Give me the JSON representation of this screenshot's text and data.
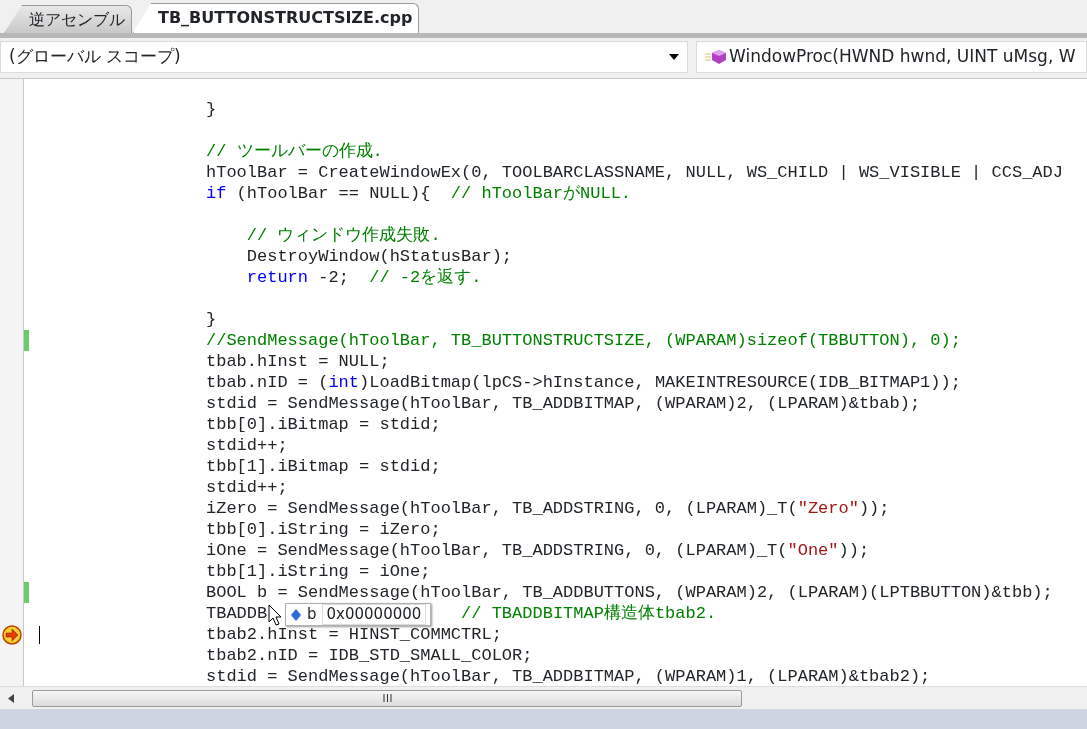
{
  "tabs": [
    {
      "label": "逆アセンブル",
      "selected": false
    },
    {
      "label": "TB_BUTTONSTRUCTSIZE.cpp",
      "selected": true
    }
  ],
  "scope_dropdown": {
    "value": "(グローバル スコープ)"
  },
  "member_dropdown": {
    "value": "WindowProc(HWND hwnd, UINT uMsg, W"
  },
  "code_lines": [
    {
      "changed": false,
      "current": false,
      "segments": [
        {
          "kind": "plain",
          "text": "}"
        }
      ]
    },
    {
      "changed": false,
      "current": false
    },
    {
      "changed": false,
      "current": false,
      "segments": [
        {
          "kind": "comment",
          "text": "// ツールバーの作成."
        }
      ]
    },
    {
      "changed": false,
      "current": false,
      "segments": [
        {
          "kind": "plain",
          "text": "hToolBar = CreateWindowEx(0, TOOLBARCLASSNAME, NULL, WS_CHILD | WS_VISIBLE | CCS_ADJ"
        }
      ]
    },
    {
      "changed": false,
      "current": false,
      "segments": [
        {
          "kind": "keyword",
          "text": "if"
        },
        {
          "kind": "plain",
          "text": " (hToolBar == NULL){  "
        },
        {
          "kind": "comment",
          "text": "// hToolBarがNULL."
        }
      ]
    },
    {
      "changed": false,
      "current": false
    },
    {
      "changed": false,
      "current": false,
      "segments": [
        {
          "kind": "comment",
          "text": "    // ウィンドウ作成失敗."
        }
      ]
    },
    {
      "changed": false,
      "current": false,
      "segments": [
        {
          "kind": "plain",
          "text": "    DestroyWindow(hStatusBar);"
        }
      ]
    },
    {
      "changed": false,
      "current": false,
      "segments": [
        {
          "kind": "keyword",
          "text": "    return"
        },
        {
          "kind": "plain",
          "text": " -2;  "
        },
        {
          "kind": "comment",
          "text": "// -2を返す."
        }
      ]
    },
    {
      "changed": false,
      "current": false
    },
    {
      "changed": false,
      "current": false,
      "segments": [
        {
          "kind": "plain",
          "text": "}"
        }
      ]
    },
    {
      "changed": true,
      "current": false,
      "segments": [
        {
          "kind": "comment",
          "text": "//SendMessage(hToolBar, TB_BUTTONSTRUCTSIZE, (WPARAM)sizeof(TBBUTTON), 0);"
        }
      ]
    },
    {
      "changed": false,
      "current": false,
      "segments": [
        {
          "kind": "plain",
          "text": "tbab.hInst = NULL;"
        }
      ]
    },
    {
      "changed": false,
      "current": false,
      "segments": [
        {
          "kind": "plain",
          "text": "tbab.nID = ("
        },
        {
          "kind": "keyword",
          "text": "int"
        },
        {
          "kind": "plain",
          "text": ")LoadBitmap(lpCS->hInstance, MAKEINTRESOURCE(IDB_BITMAP1));"
        }
      ]
    },
    {
      "changed": false,
      "current": false,
      "segments": [
        {
          "kind": "plain",
          "text": "stdid = SendMessage(hToolBar, TB_ADDBITMAP, (WPARAM)2, (LPARAM)&tbab);"
        }
      ]
    },
    {
      "changed": false,
      "current": false,
      "segments": [
        {
          "kind": "plain",
          "text": "tbb[0].iBitmap = stdid;"
        }
      ]
    },
    {
      "changed": false,
      "current": false,
      "segments": [
        {
          "kind": "plain",
          "text": "stdid++;"
        }
      ]
    },
    {
      "changed": false,
      "current": false,
      "segments": [
        {
          "kind": "plain",
          "text": "tbb[1].iBitmap = stdid;"
        }
      ]
    },
    {
      "changed": false,
      "current": false,
      "segments": [
        {
          "kind": "plain",
          "text": "stdid++;"
        }
      ]
    },
    {
      "changed": false,
      "current": false,
      "segments": [
        {
          "kind": "plain",
          "text": "iZero = SendMessage(hToolBar, TB_ADDSTRING, 0, (LPARAM)_T("
        },
        {
          "kind": "string",
          "text": "\"Zero\""
        },
        {
          "kind": "plain",
          "text": "));"
        }
      ]
    },
    {
      "changed": false,
      "current": false,
      "segments": [
        {
          "kind": "plain",
          "text": "tbb[0].iString = iZero;"
        }
      ]
    },
    {
      "changed": false,
      "current": false,
      "segments": [
        {
          "kind": "plain",
          "text": "iOne = SendMessage(hToolBar, TB_ADDSTRING, 0, (LPARAM)_T("
        },
        {
          "kind": "string",
          "text": "\"One\""
        },
        {
          "kind": "plain",
          "text": "));"
        }
      ]
    },
    {
      "changed": false,
      "current": false,
      "segments": [
        {
          "kind": "plain",
          "text": "tbb[1].iString = iOne;"
        }
      ]
    },
    {
      "changed": true,
      "current": false,
      "segments": [
        {
          "kind": "plain",
          "text": "BOOL b = SendMessage(hToolBar, TB_ADDBUTTONS, (WPARAM)2, (LPARAM)(LPTBBUTTON)&tbb);"
        }
      ]
    },
    {
      "changed": false,
      "current": false,
      "segments": [
        {
          "kind": "plain",
          "text": "TBADDB"
        },
        {
          "kind": "comment",
          "text": "                   // TBADDBITMAP構造体tbab2."
        }
      ]
    },
    {
      "changed": false,
      "current": true,
      "segments": [
        {
          "kind": "plain",
          "text": "tbab2.hInst = HINST_COMMCTRL;"
        }
      ]
    },
    {
      "changed": false,
      "current": false,
      "segments": [
        {
          "kind": "plain",
          "text": "tbab2.nID = IDB_STD_SMALL_COLOR;"
        }
      ]
    },
    {
      "changed": false,
      "current": false,
      "segments": [
        {
          "kind": "plain",
          "text": "stdid = SendMessage(hToolBar, TB_ADDBITMAP, (WPARAM)1, (LPARAM)&tbab2);"
        }
      ]
    }
  ],
  "tooltip": {
    "name": "b",
    "value": "0x00000000"
  }
}
